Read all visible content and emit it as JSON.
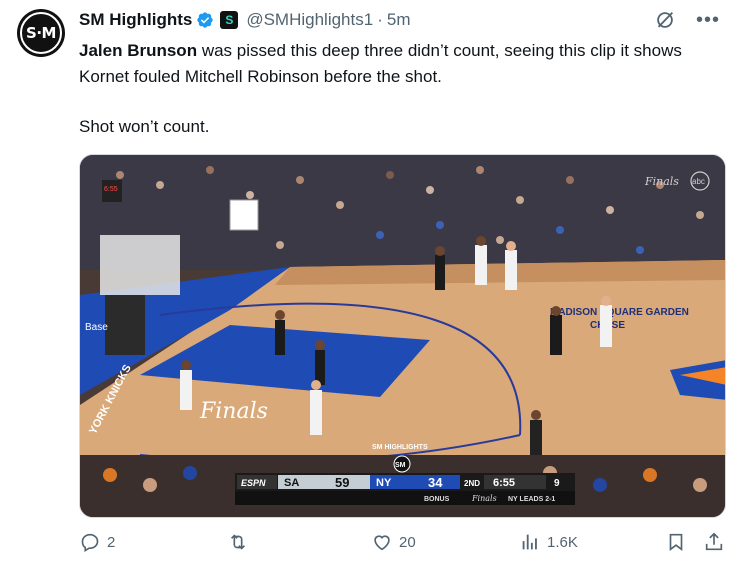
{
  "author": {
    "avatar_text": "S·M",
    "name": "SM Highlights",
    "handle": "@SMHighlights1",
    "separator": "·",
    "time": "5m",
    "affiliate_badge": "S"
  },
  "tweet": {
    "bold_name": "Jalen Brunson",
    "text_rest": " was pissed this deep three didn’t count, seeing this clip it shows Kornet fouled Mitchell Robinson before the shot.",
    "text_line2": "Shot won’t count."
  },
  "media": {
    "watermark": "SM HIGHLIGHTS",
    "watermark_logo": "SM",
    "arena_text": "MADISON SQUARE GARDEN",
    "arena_sub": "CHASE",
    "floor_text_1": "KNICKS",
    "floor_text_2": "Finals",
    "floor_side": "YORK KNICKS",
    "board_left": "Base",
    "shot_clock": "6:55",
    "scoreboard": {
      "network": "ESPN",
      "team1": "SA",
      "score1": "59",
      "team2": "NY",
      "score2": "34",
      "quarter": "2ND",
      "clock": "6:55",
      "shot_clock": "9",
      "bonus_label": "BONUS",
      "series_logo": "Finals",
      "series": "NY LEADS 2-1"
    },
    "corner_logo_1": "Finals",
    "corner_logo_2": "abc"
  },
  "actions": {
    "replies": "2",
    "retweets": "",
    "likes": "20",
    "views": "1.6K"
  },
  "colors": {
    "verified": "#1d9bf0",
    "text_secondary": "#536471",
    "court_blue": "#1f4bb5",
    "knicks_orange": "#f58426"
  }
}
